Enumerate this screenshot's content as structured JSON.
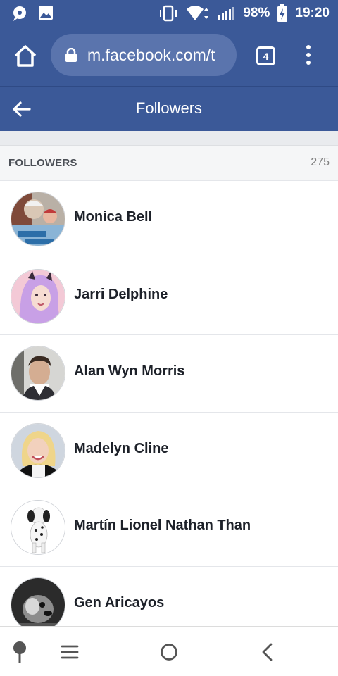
{
  "status_bar": {
    "battery": "98%",
    "time": "19:20"
  },
  "browser": {
    "url": "m.facebook.com/t",
    "tab_count": "4"
  },
  "header": {
    "title": "Followers"
  },
  "section": {
    "title": "FOLLOWERS",
    "count": "275"
  },
  "followers": [
    {
      "name": "Monica Bell"
    },
    {
      "name": "Jarri Delphine"
    },
    {
      "name": "Alan Wyn Morris"
    },
    {
      "name": "Madelyn Cline"
    },
    {
      "name": "Martín Lionel Nathan Than"
    },
    {
      "name": "Gen Aricayos"
    }
  ],
  "colors": {
    "brand_blue": "#3b5998",
    "url_pill": "#5a74ad",
    "section_bg": "#f5f6f7",
    "name_text": "#1d2129"
  },
  "icons": {
    "status_left": [
      "chat-bubble-icon",
      "image-icon"
    ],
    "status_right": [
      "vibrate-icon",
      "wifi-icon",
      "signal-icon",
      "battery-icon"
    ],
    "browser": [
      "home-icon",
      "lock-icon",
      "tabs-icon",
      "more-vert-icon"
    ],
    "header": [
      "arrow-back-icon"
    ],
    "nav": [
      "pin-icon",
      "menu-icon",
      "home-circle-icon",
      "back-chevron-icon"
    ]
  }
}
